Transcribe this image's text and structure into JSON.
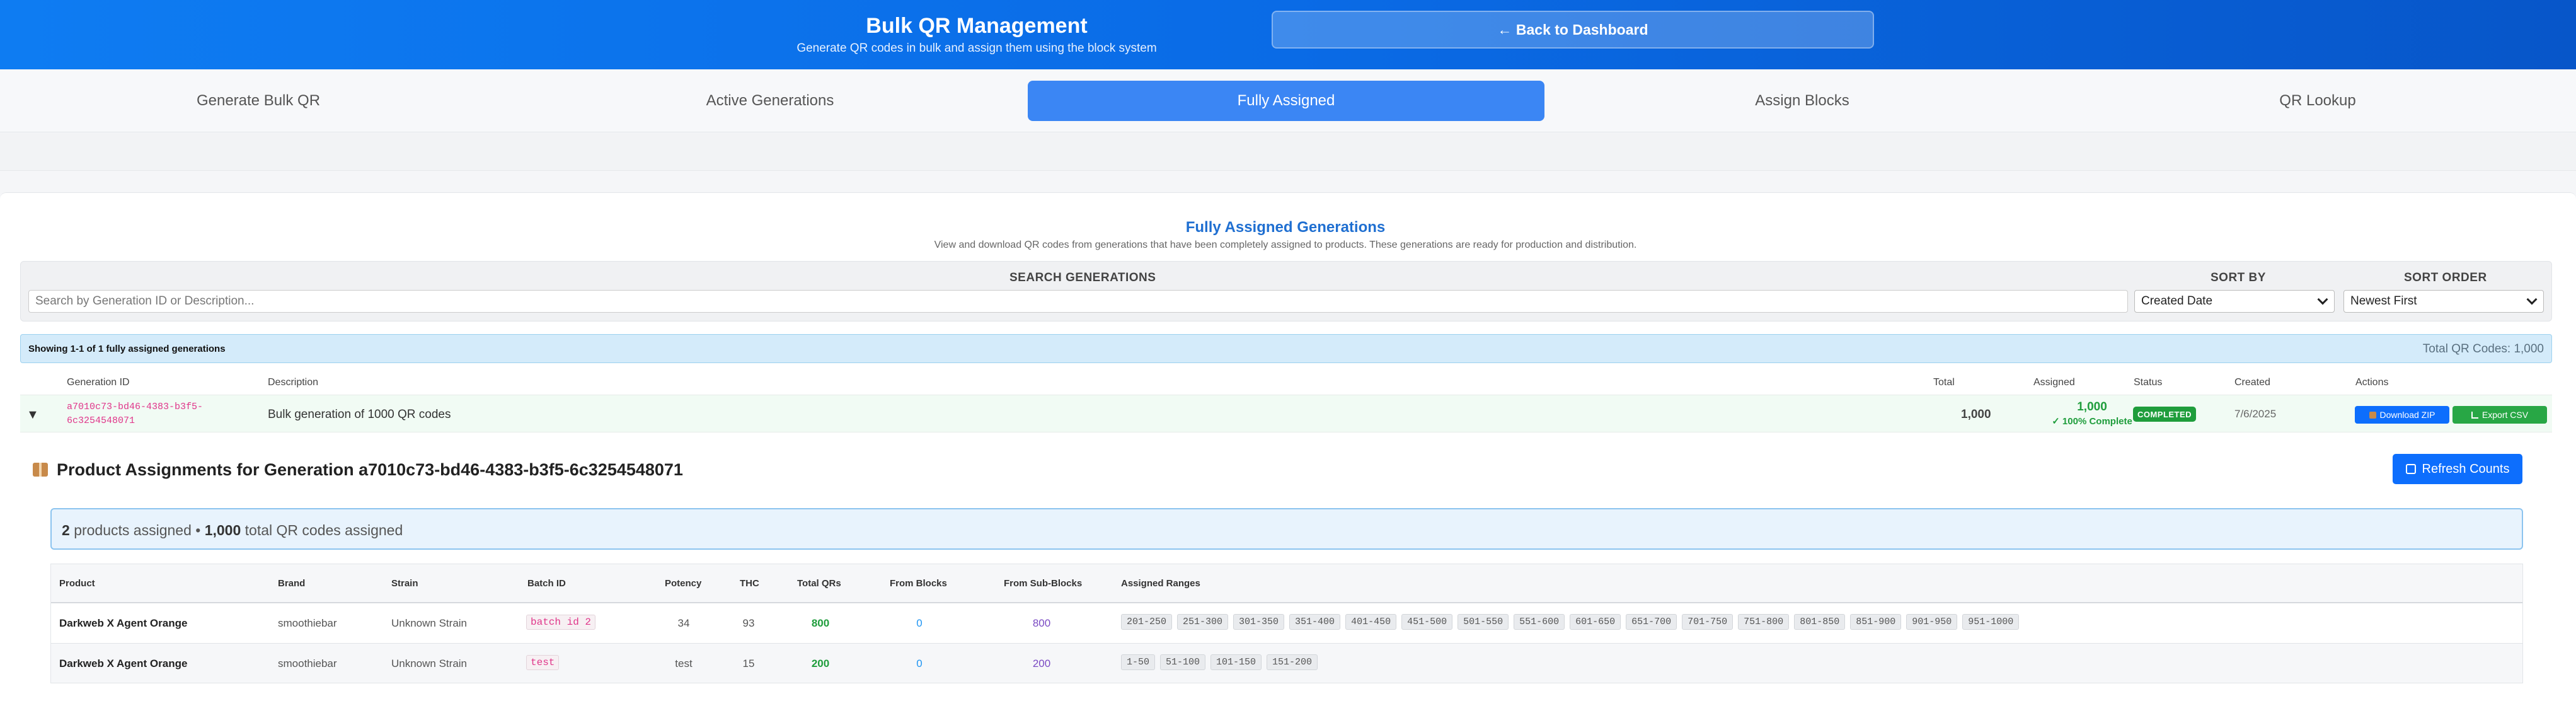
{
  "header": {
    "title": "Bulk QR Management",
    "subtitle": "Generate QR codes in bulk and assign them using the block system",
    "back_label": "← Back to Dashboard"
  },
  "tabs": [
    {
      "label": "Generate Bulk QR",
      "active": false
    },
    {
      "label": "Active Generations",
      "active": false
    },
    {
      "label": "Fully Assigned",
      "active": true
    },
    {
      "label": "Assign Blocks",
      "active": false
    },
    {
      "label": "QR Lookup",
      "active": false
    }
  ],
  "section": {
    "title": "Fully Assigned Generations",
    "description": "View and download QR codes from generations that have been completely assigned to products. These generations are ready for production and distribution."
  },
  "filters": {
    "search_label": "SEARCH GENERATIONS",
    "search_placeholder": "Search by Generation ID or Description...",
    "sort_by_label": "SORT BY",
    "sort_by_value": "Created Date",
    "sort_order_label": "SORT ORDER",
    "sort_order_value": "Newest First"
  },
  "results": {
    "showing": "Showing 1-1 of 1 fully assigned generations",
    "total_codes": "Total QR Codes: 1,000"
  },
  "table": {
    "headers": [
      "Generation ID",
      "Description",
      "Total",
      "Assigned",
      "Status",
      "Created",
      "Actions"
    ],
    "row": {
      "caret": "▼",
      "id_line1": "a7010c73-bd46-4383-b3f5-",
      "id_line2": "6c3254548071",
      "description": "Bulk generation of 1000 QR codes",
      "total": "1,000",
      "assigned": "1,000",
      "assigned_pct": "✓ 100% Complete",
      "status": "COMPLETED",
      "created": "7/6/2025",
      "download_label": "Download ZIP",
      "export_label": "Export CSV"
    }
  },
  "assignments": {
    "title": "Product Assignments for Generation a7010c73-bd46-4383-b3f5-6c3254548071",
    "refresh_label": "Refresh Counts",
    "summary_products": "2",
    "summary_products_text": "products assigned •",
    "summary_total": "1,000",
    "summary_total_text": "total QR codes assigned",
    "headers": [
      "Product",
      "Brand",
      "Strain",
      "Batch ID",
      "Potency",
      "THC",
      "Total QRs",
      "From Blocks",
      "From Sub-Blocks",
      "Assigned Ranges"
    ],
    "rows": [
      {
        "product": "Darkweb X Agent Orange",
        "brand": "smoothiebar",
        "strain": "Unknown Strain",
        "batch": "batch id 2",
        "potency": "34",
        "thc": "93",
        "total": "800",
        "from_blocks": "0",
        "from_sub_blocks": "800",
        "ranges": [
          "201-250",
          "251-300",
          "301-350",
          "351-400",
          "401-450",
          "451-500",
          "501-550",
          "551-600",
          "601-650",
          "651-700",
          "701-750",
          "751-800",
          "801-850",
          "851-900",
          "901-950",
          "951-1000"
        ]
      },
      {
        "product": "Darkweb X Agent Orange",
        "brand": "smoothiebar",
        "strain": "Unknown Strain",
        "batch": "test",
        "potency": "test",
        "thc": "15",
        "total": "200",
        "from_blocks": "0",
        "from_sub_blocks": "200",
        "ranges": [
          "1-50",
          "51-100",
          "101-150",
          "151-200"
        ]
      }
    ]
  },
  "colors": {
    "header_blue": "#0a6be6",
    "active_tab": "#3b86f4",
    "success_green": "#1f9d3c",
    "id_pink": "#e0368a",
    "blocks_blue": "#2196f3",
    "subblocks_purple": "#7b4bc4"
  }
}
